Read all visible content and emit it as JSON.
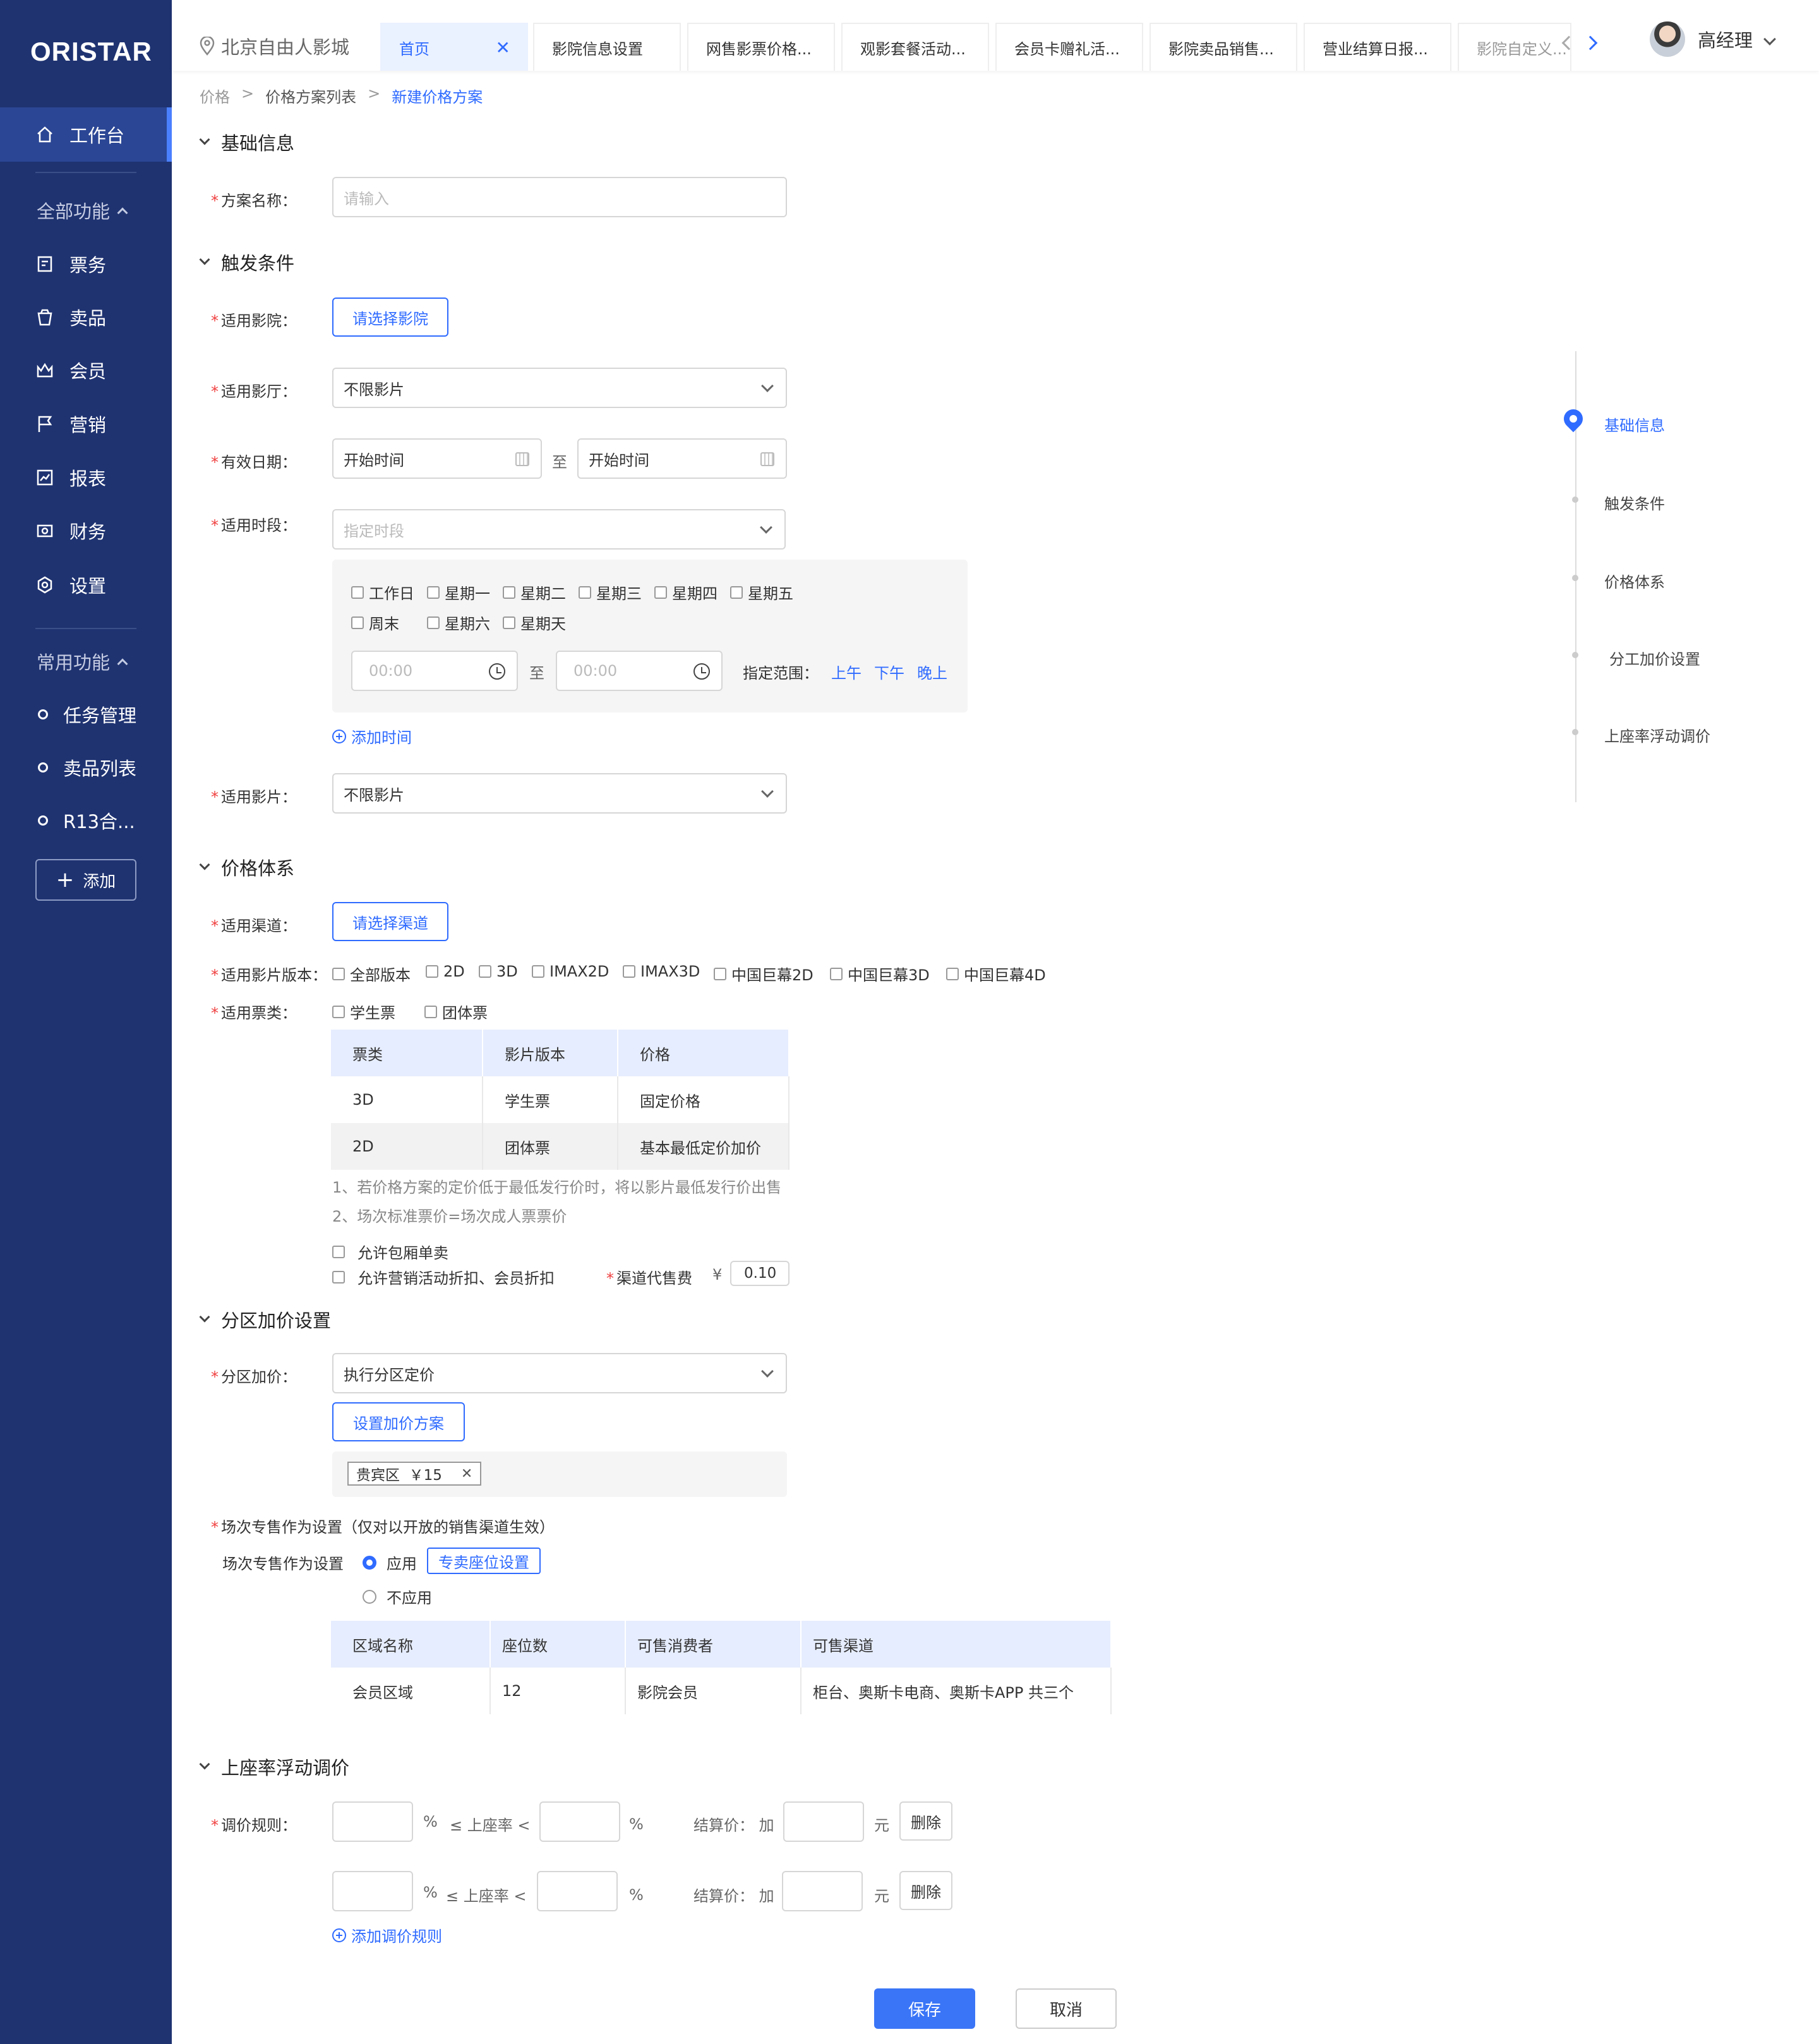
{
  "app": {
    "logo": "ORISTAR",
    "location": "北京自由人影城",
    "user_name": "高经理"
  },
  "sidebar": {
    "workbench": "工作台",
    "all_functions": "全部功能",
    "items": [
      "票务",
      "卖品",
      "会员",
      "营销",
      "报表",
      "财务",
      "设置"
    ],
    "common_functions": "常用功能",
    "common_items": [
      "任务管理",
      "卖品列表",
      "R13合..."
    ],
    "add_label": "添加"
  },
  "tabs": [
    {
      "label": "首页",
      "active": true
    },
    {
      "label": "影院信息设置"
    },
    {
      "label": "网售影票价格..."
    },
    {
      "label": "观影套餐活动..."
    },
    {
      "label": "会员卡赠礼活..."
    },
    {
      "label": "影院卖品销售..."
    },
    {
      "label": "营业结算日报..."
    },
    {
      "label": "影院自定义..."
    }
  ],
  "breadcrumb": [
    "价格",
    ">",
    "价格方案列表",
    ">",
    "新建价格方案"
  ],
  "sections": {
    "basic": "基础信息",
    "trigger": "触发条件",
    "price": "价格体系",
    "zone": "分区加价设置",
    "occupancy": "上座率浮动调价"
  },
  "basic": {
    "name_label": "方案名称：",
    "name_placeholder": "请输入"
  },
  "trigger": {
    "cinema_label": "适用影院：",
    "cinema_btn": "请选择影院",
    "hall_label": "适用影厅：",
    "hall_value": "不限影片",
    "date_label": "有效日期：",
    "date_start": "开始时间",
    "date_to": "至",
    "date_end": "开始时间",
    "period_label": "适用时段：",
    "period_placeholder": "指定时段",
    "days_row1": [
      "工作日",
      "星期一",
      "星期二",
      "星期三",
      "星期四",
      "星期五"
    ],
    "days_row2": [
      "周末",
      "星期六",
      "星期天"
    ],
    "time_start": "00:00",
    "time_to": "至",
    "time_end": "00:00",
    "range_label": "指定范围：",
    "range_options": [
      "上午",
      "下午",
      "晚上"
    ],
    "add_time": "添加时间",
    "film_label": "适用影片：",
    "film_value": "不限影片"
  },
  "price": {
    "channel_label": "适用渠道：",
    "channel_btn": "请选择渠道",
    "version_label": "适用影片版本：",
    "versions": [
      "全部版本",
      "2D",
      "3D",
      "IMAX2D",
      "IMAX3D",
      "中国巨幕2D",
      "中国巨幕3D",
      "中国巨幕4D"
    ],
    "ticket_label": "适用票类：",
    "tickets": [
      "学生票",
      "团体票"
    ],
    "table_headers": [
      "票类",
      "影片版本",
      "价格"
    ],
    "table_rows": [
      [
        "3D",
        "学生票",
        "固定价格"
      ],
      [
        "2D",
        "团体票",
        "基本最低定价加价"
      ]
    ],
    "note1": "1、若价格方案的定价低于最低发行价时，将以影片最低发行价出售",
    "note2": "2、场次标准票价=场次成人票票价",
    "allow_private": "允许包厢单卖",
    "allow_discount": "允许营销活动折扣、会员折扣",
    "fee_label": "渠道代售费",
    "fee_currency": "¥",
    "fee_value": "0.10"
  },
  "zone": {
    "label": "分区加价：",
    "value": "执行分区定价",
    "btn": "设置加价方案",
    "tag": "贵宾区  ￥15",
    "exclusive_title": "场次专售作为设置（仅对以开放的销售渠道生效）",
    "exclusive_label": "场次专售作为设置",
    "apply": "应用",
    "seat_btn": "专卖座位设置",
    "not_apply": "不应用",
    "table_headers": [
      "区域名称",
      "座位数",
      "可售消费者",
      "可售渠道"
    ],
    "table_rows": [
      [
        "会员区域",
        "12",
        "影院会员",
        "柜台、奥斯卡电商、奥斯卡APP 共三个"
      ]
    ]
  },
  "occupancy": {
    "rule_label": "调价规则：",
    "pct": "%",
    "leq": "≤ 上座率 <",
    "settle": "结算价：  加",
    "yuan": "元",
    "delete": "删除",
    "add_rule": "添加调价规则"
  },
  "anchor": [
    "基础信息",
    "触发条件",
    "价格体系",
    "分工加价设置",
    "上座率浮动调价"
  ],
  "actions": {
    "save": "保存",
    "cancel": "取消"
  },
  "colors": {
    "sidebar": "#1f3371",
    "accent": "#2f6bff",
    "required": "#f04040"
  }
}
